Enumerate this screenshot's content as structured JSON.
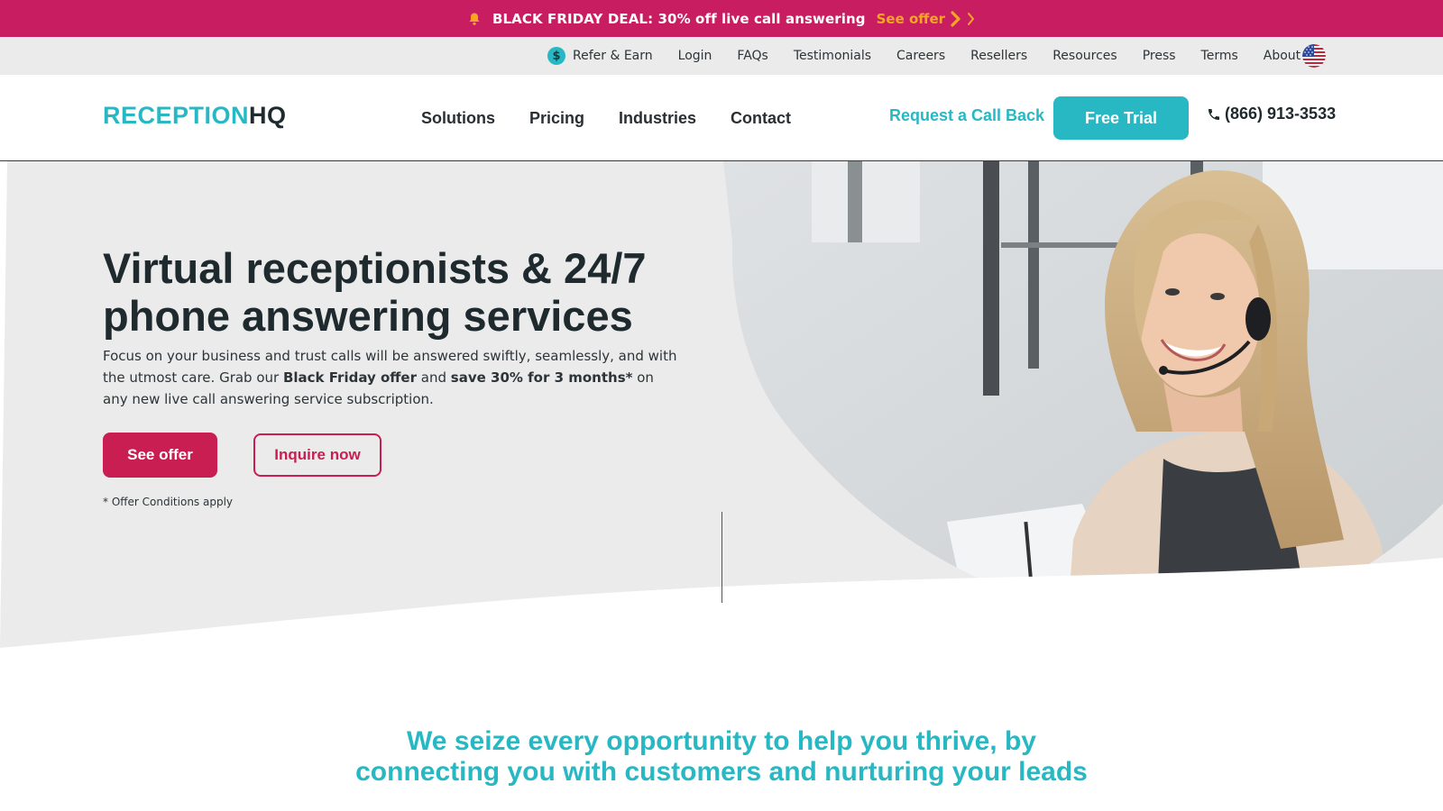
{
  "promo": {
    "text": "BLACK FRIDAY DEAL: 30% off live call answering",
    "link": "See offer",
    "icon": "bell-icon",
    "background": "#c81e61",
    "link_color": "#f6a623"
  },
  "utility_nav": {
    "items": [
      "Refer & Earn",
      "Login",
      "FAQs",
      "Testimonials",
      "Careers",
      "Resellers",
      "Resources",
      "Press",
      "Terms",
      "About"
    ],
    "refer_icon": "dollar-coin-icon",
    "locale_icon": "us-flag-icon"
  },
  "header": {
    "logo_part1": "RECEPTION",
    "logo_part2": "HQ",
    "nav": [
      "Solutions",
      "Pricing",
      "Industries",
      "Contact"
    ],
    "callback": "Request a Call Back",
    "trial": "Free Trial",
    "phone": "(866) 913-3533",
    "accent": "#27b8c4"
  },
  "hero": {
    "title": "Virtual receptionists & 24/7 phone answering services",
    "desc_1": "Focus on your business and trust calls will be answered swiftly, seamlessly, and with the utmost care. Grab our ",
    "desc_bold_1": "Black Friday offer",
    "desc_2": " and ",
    "desc_bold_2": "save 30% for 3 months*",
    "desc_3": " on any new live call answering service subscription.",
    "primary_button": "See offer",
    "secondary_button": "Inquire now",
    "conditions": "* Offer Conditions apply",
    "brand_red": "#c81e52"
  },
  "tagline": {
    "line1": "We seize every opportunity to help you thrive, by",
    "line2": "connecting you with customers and nurturing your leads"
  }
}
